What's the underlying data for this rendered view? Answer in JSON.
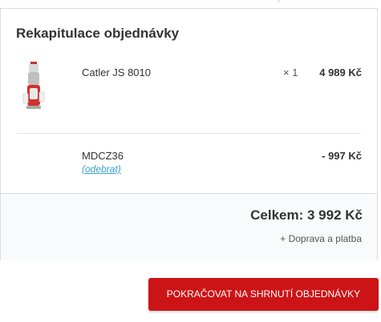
{
  "summary": {
    "title": "Rekapitulace objednávky",
    "items": [
      {
        "name": "Catler JS 8010",
        "quantity": "× 1",
        "price": "4 989 Kč",
        "image_icon": "juicer-product-image"
      }
    ],
    "discount": {
      "code": "MDCZ36",
      "remove_label": "(odebrat)",
      "amount": "- 997 Kč"
    },
    "total": "Celkem: 3 992 Kč",
    "shipping_note": "+ Doprava a platba"
  },
  "cta": {
    "label": "POKRAČOVAT NA SHRNUTÍ OBJEDNÁVKY",
    "color": "#cc1417"
  },
  "colors": {
    "link": "#3aa0d0",
    "border": "#dcdcdc",
    "text": "#333333"
  }
}
